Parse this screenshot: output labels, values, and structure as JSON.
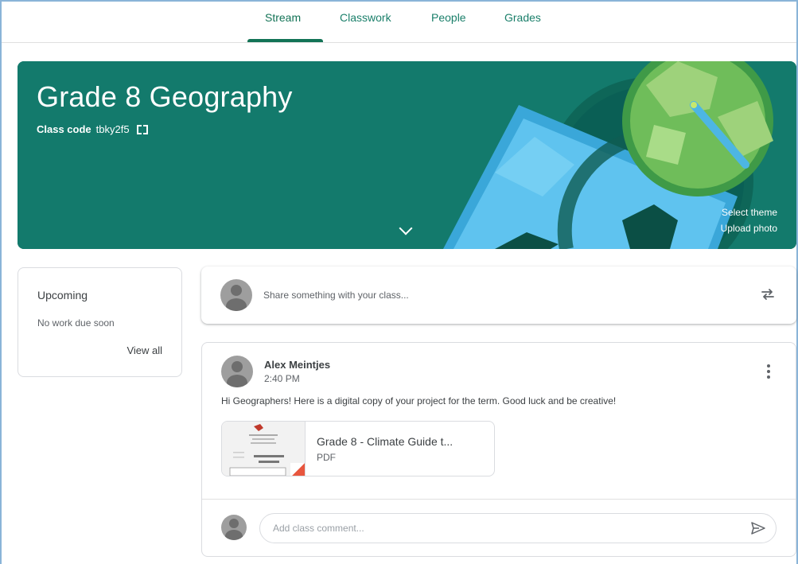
{
  "nav": {
    "tabs": [
      {
        "label": "Stream"
      },
      {
        "label": "Classwork"
      },
      {
        "label": "People"
      },
      {
        "label": "Grades"
      }
    ],
    "active_tab": "Stream"
  },
  "banner": {
    "title": "Grade 8 Geography",
    "class_code_label": "Class code",
    "class_code": "tbky2f5",
    "select_theme": "Select theme",
    "upload_photo": "Upload photo",
    "color": "#137a6c"
  },
  "upcoming": {
    "title": "Upcoming",
    "empty_text": "No work due soon",
    "view_all": "View all"
  },
  "share": {
    "placeholder": "Share something with your class..."
  },
  "post": {
    "author": "Alex Meintjes",
    "time": "2:40 PM",
    "text": "Hi Geographers! Here is a digital copy of your project for the term. Good luck and be creative!",
    "attachment": {
      "title": "Grade 8 - Climate Guide t...",
      "type": "PDF"
    },
    "comment_placeholder": "Add class comment..."
  },
  "colors": {
    "accent": "#137356",
    "text": "#3c4043",
    "muted": "#5f6368"
  }
}
